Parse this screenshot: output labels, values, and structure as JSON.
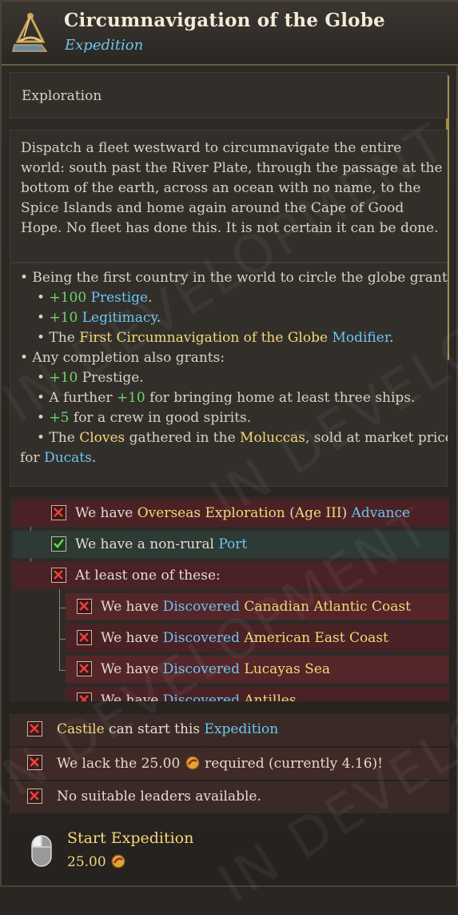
{
  "header": {
    "title": "Circumnavigation of the Globe",
    "subtitle": "Expedition",
    "icon": "sextant-icon"
  },
  "category": "Exploration",
  "description": "Dispatch a fleet westward to circumnavigate the entire world: south past the River Plate, through the passage at the bottom of the earth, across an ocean with no name, to the Spice Islands and home again around the Cape of Good Hope. No fleet has done this. It is not certain it can be done.",
  "effects": {
    "first_intro": "• Being the first country in the world to circle the globe grants:",
    "prestige_amount": "+100",
    "prestige": "Prestige",
    "legit_amount": "+10",
    "legitimacy": "Legitimacy",
    "the": "• The",
    "modifier_name": "First Circumnavigation of the Globe",
    "modifier": "Modifier",
    "any_intro": "• Any completion also grants:",
    "any_prestige_amount": "+10",
    "any_prestige": "Prestige.",
    "further_a": "• A further",
    "further_amount": "+10",
    "further_b": "for bringing home at least three ships.",
    "crew_amount": "+5",
    "crew_text": "for a crew in good spirits.",
    "cloves_a": "• The",
    "cloves": "Cloves",
    "cloves_b": "gathered in the",
    "moluccas": "Moluccas",
    "cloves_c": ", sold at market price",
    "for": "for",
    "ducats": "Ducats"
  },
  "requirements": {
    "r1_a": "We have",
    "r1_b": "Overseas Exploration",
    "r1_c": "(",
    "r1_d": "Age III",
    "r1_e": ")",
    "r1_f": "Advance",
    "r2_a": "We have a non-rural",
    "r2_b": "Port",
    "r3": "At least one of these:",
    "we_have": "We have",
    "discovered": "Discovered",
    "loc1": "Canadian Atlantic Coast",
    "loc2": "American East Coast",
    "loc3": "Lucayas Sea",
    "loc4": "Antilles"
  },
  "conditions": {
    "c1_a": "Castile",
    "c1_b": "can start this",
    "c1_c": "Expedition",
    "c2_a": "We lack the",
    "c2_amount": "25.00",
    "c2_b": "required (currently 4.16)!",
    "c3": "No suitable leaders available."
  },
  "action": {
    "label": "Start Expedition",
    "cost": "25.00"
  },
  "watermark": "IN DEVELOPMENT",
  "colors": {
    "positive": "#6fd36a",
    "link": "#6cc4f0",
    "highlight": "#f4d778",
    "fail_row": "#4a2225",
    "ok_row": "#2d3a35"
  }
}
